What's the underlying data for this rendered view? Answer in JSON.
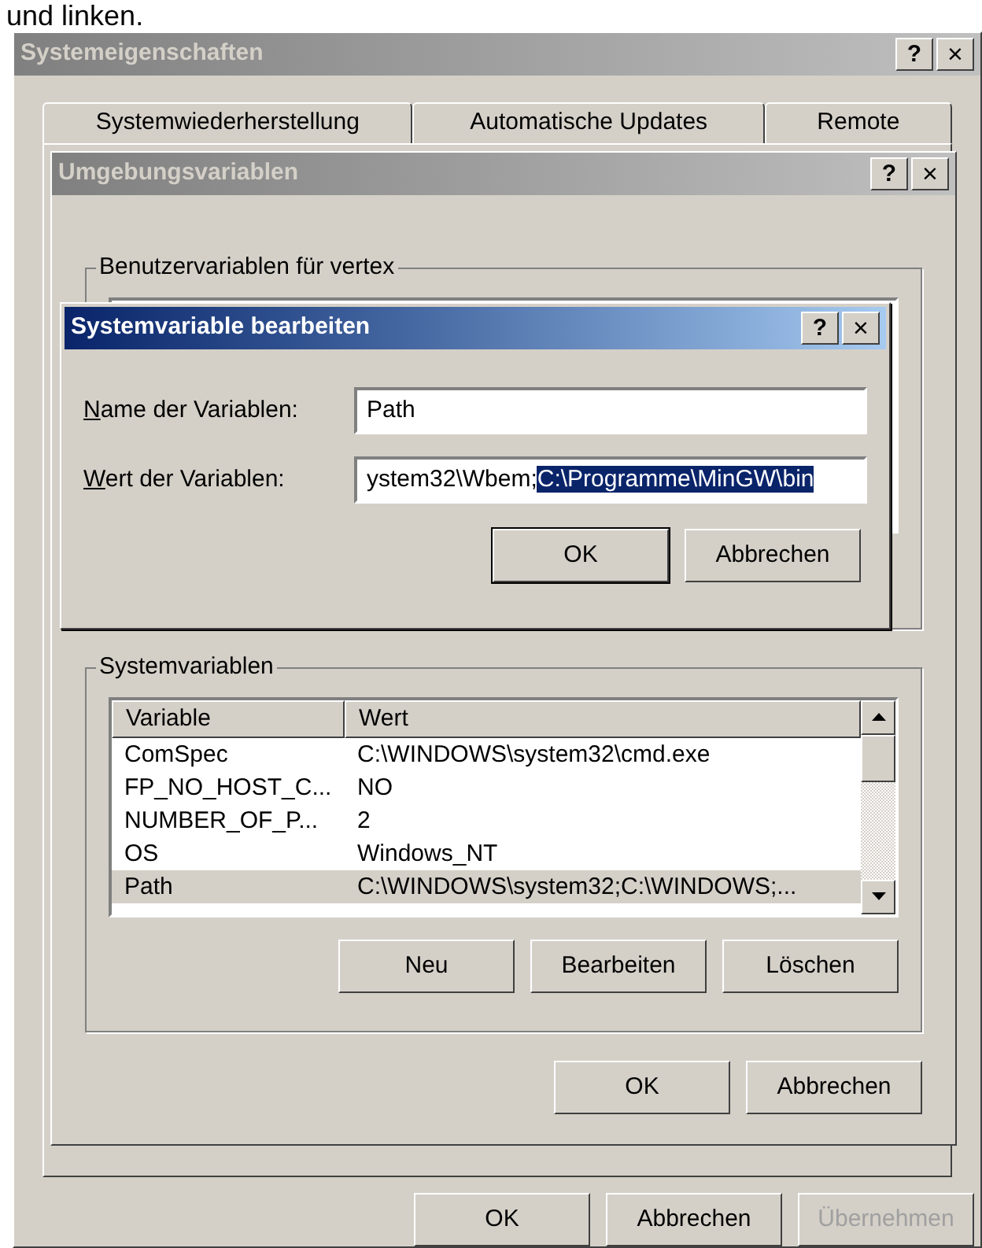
{
  "caption": "und linken.",
  "window": {
    "title": "Systemeigenschaften",
    "help": "?",
    "close": "×"
  },
  "tabs": [
    {
      "label": "Systemwiederherstellung",
      "selected": false
    },
    {
      "label": "Automatische Updates",
      "selected": false
    },
    {
      "label": "Remote",
      "selected": false
    }
  ],
  "env_dialog": {
    "title": "Umgebungsvariablen",
    "help": "?",
    "close": "×",
    "user_group": {
      "title": "Benutzervariablen für vertex"
    },
    "system_group": {
      "title": "Systemvariablen",
      "columns": [
        "Variable",
        "Wert"
      ],
      "rows": [
        {
          "variable": "ComSpec",
          "value": "C:\\WINDOWS\\system32\\cmd.exe",
          "selected": false
        },
        {
          "variable": "FP_NO_HOST_C...",
          "value": "NO",
          "selected": false
        },
        {
          "variable": "NUMBER_OF_P...",
          "value": "2",
          "selected": false
        },
        {
          "variable": "OS",
          "value": "Windows_NT",
          "selected": false
        },
        {
          "variable": "Path",
          "value": "C:\\WINDOWS\\system32;C:\\WINDOWS;...",
          "selected": true
        }
      ],
      "buttons": [
        {
          "label": "Neu",
          "disabled": false
        },
        {
          "label": "Bearbeiten",
          "disabled": false
        },
        {
          "label": "Löschen",
          "disabled": false
        }
      ]
    },
    "buttons": [
      {
        "label": "OK",
        "disabled": false
      },
      {
        "label": "Abbrechen",
        "disabled": false
      }
    ]
  },
  "edit_dialog": {
    "title": "Systemvariable bearbeiten",
    "help": "?",
    "close": "×",
    "name_label": {
      "mnemonic": "N",
      "rest": "ame der Variablen:"
    },
    "name_value": "Path",
    "value_label": {
      "mnemonic": "W",
      "rest": "ert der Variablen:"
    },
    "value_text": "ystem32\\Wbem;",
    "value_selected": "C:\\Programme\\MinGW\\bin",
    "buttons": [
      {
        "label": "OK",
        "disabled": false,
        "default": true
      },
      {
        "label": "Abbrechen",
        "disabled": false,
        "default": false
      }
    ]
  },
  "buttons": [
    {
      "label": "OK",
      "disabled": false
    },
    {
      "label": "Abbrechen",
      "disabled": false
    },
    {
      "label": "Übernehmen",
      "disabled": true
    }
  ]
}
